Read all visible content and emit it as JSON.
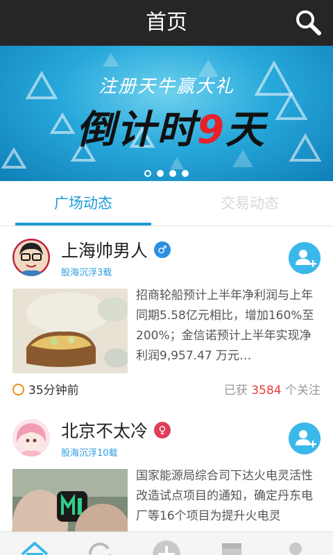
{
  "header": {
    "title": "首页",
    "search_icon": "search-icon"
  },
  "banner": {
    "subtitle": "注册天牛赢大礼",
    "headline_prefix": "倒计时",
    "headline_number": "9",
    "headline_suffix": "天",
    "page_count": 4,
    "active_page": 1
  },
  "tabs": [
    {
      "label": "广场动态",
      "active": true
    },
    {
      "label": "交易动态",
      "active": false
    }
  ],
  "posts": [
    {
      "user": "上海帅男人",
      "gender": "male",
      "gender_symbol": "♂",
      "rank": "股海沉浮3载",
      "text": "招商轮船预计上半年净利润与上年同期5.58亿元相比，增加160%至200%；金信诺预计上半年实现净利润9,957.47 万元…",
      "time": "35分钟前",
      "follow_prefix": "已获",
      "follow_count": "3584",
      "follow_suffix": "个关注"
    },
    {
      "user": "北京不太冷",
      "gender": "female",
      "gender_symbol": "♀",
      "rank": "股海沉浮10载",
      "text": "国家能源局综合司下达火电灵活性改造试点项目的通知，确定丹东电厂等16个项目为提升火电灵"
    }
  ],
  "bottom_nav": [
    "home-icon",
    "refresh-icon",
    "add-icon",
    "box-icon",
    "user-icon"
  ],
  "colors": {
    "accent": "#1b9bd7",
    "topbar": "#262626",
    "highlight": "#e83a3a"
  }
}
